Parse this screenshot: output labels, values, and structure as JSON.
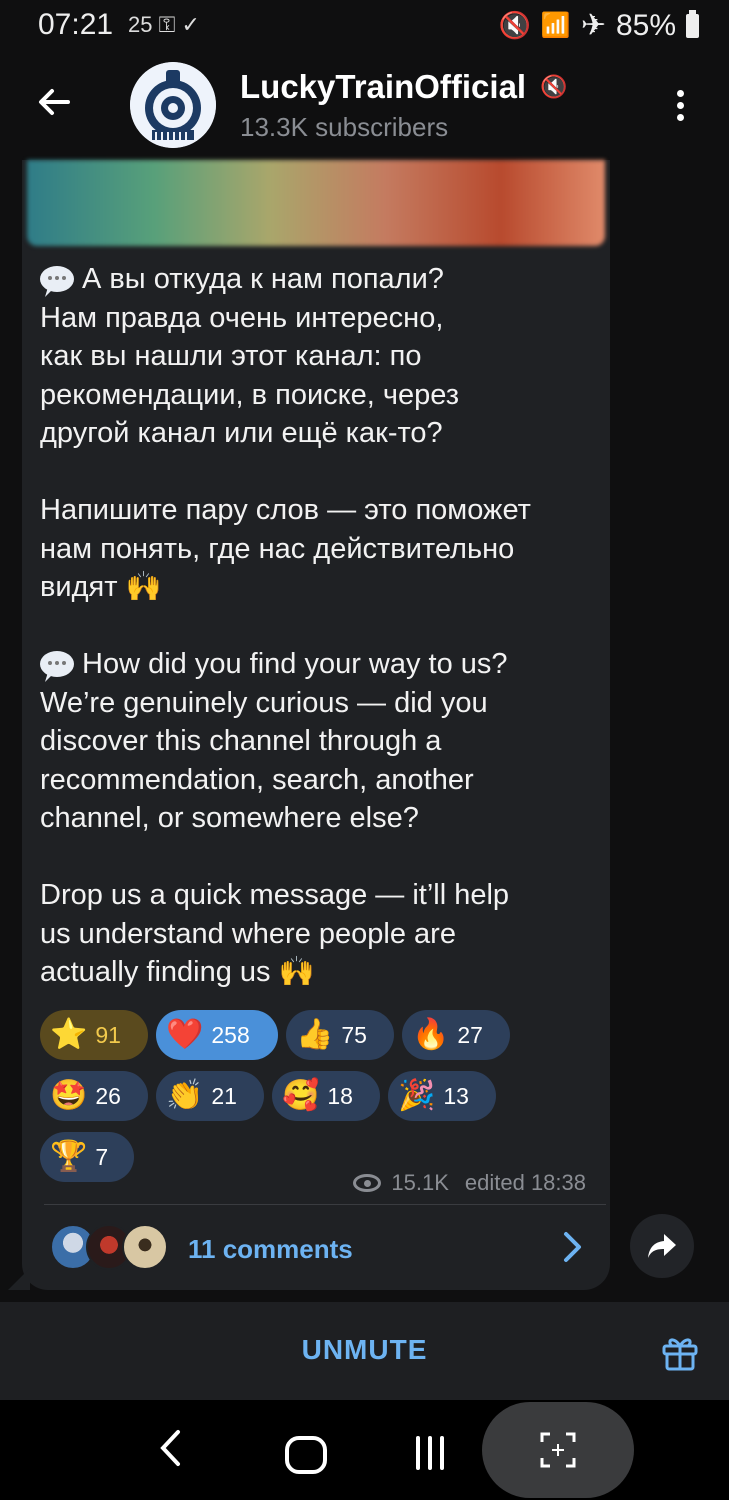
{
  "status_bar": {
    "time": "07:21",
    "extra": "25",
    "battery": "85%"
  },
  "header": {
    "channel_name": "LuckyTrainOfficial",
    "subscribers": "13.3K subscribers"
  },
  "message": {
    "paragraph_ru_1": "А вы откуда к нам попали?\nНам правда очень интересно,\nкак вы нашли этот канал: по\nрекомендации, в поиске, через\nдругой канал или ещё как-то?",
    "paragraph_ru_2": "Напишите пару слов — это поможет\nнам понять, где нас действительно\nвидят",
    "paragraph_en_1": "How did you find your way to us?\nWe’re genuinely curious — did you\ndiscover this channel through a\nrecommendation, search, another\nchannel, or somewhere else?",
    "paragraph_en_2": "Drop us a quick message — it’ll help\nus understand where people are\nactually finding us",
    "hands_emoji": "🙌"
  },
  "reactions": [
    {
      "emoji": "⭐",
      "count": "91"
    },
    {
      "emoji": "❤️",
      "count": "258"
    },
    {
      "emoji": "👍",
      "count": "75"
    },
    {
      "emoji": "🔥",
      "count": "27"
    },
    {
      "emoji": "🤩",
      "count": "26"
    },
    {
      "emoji": "👏",
      "count": "21"
    },
    {
      "emoji": "🥰",
      "count": "18"
    },
    {
      "emoji": "🎉",
      "count": "13"
    },
    {
      "emoji": "🏆",
      "count": "7"
    }
  ],
  "meta": {
    "views": "15.1K",
    "edited": "edited 18:38"
  },
  "comments": {
    "label": "11 comments"
  },
  "bottom_bar": {
    "unmute_label": "UNMUTE"
  },
  "colors": {
    "accent": "#6db3f2",
    "bubble": "#1f2124",
    "reaction_chip": "#2d3f5a",
    "reaction_active": "#4a90d9",
    "reaction_gold": "#5a4a1e"
  }
}
